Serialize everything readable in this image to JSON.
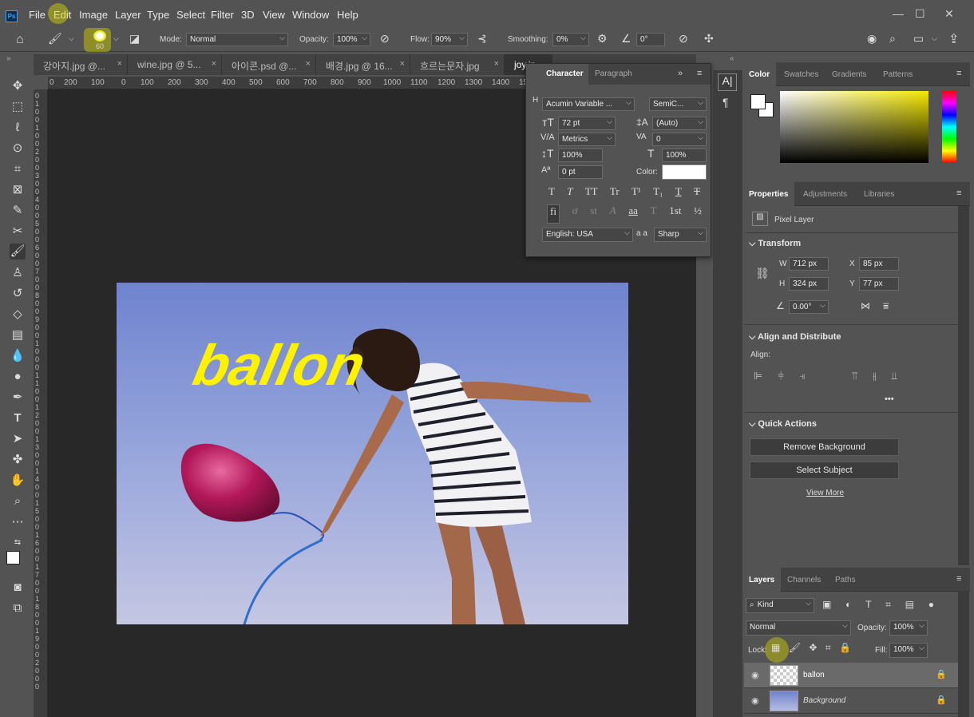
{
  "menu": [
    "File",
    "Edit",
    "Image",
    "Layer",
    "Type",
    "Select",
    "Filter",
    "3D",
    "View",
    "Window",
    "Help"
  ],
  "app_logo": "Ps",
  "window_controls": {
    "minimize": "—",
    "restore": "☐",
    "close": "✕"
  },
  "options": {
    "brush_size": "60",
    "mode_label": "Mode:",
    "mode_value": "Normal",
    "opacity_label": "Opacity:",
    "opacity_value": "100%",
    "flow_label": "Flow:",
    "flow_value": "90%",
    "smoothing_label": "Smoothing:",
    "smoothing_value": "0%",
    "angle_value": "0°"
  },
  "tabs": [
    {
      "label": "강아지.jpg @..."
    },
    {
      "label": "wine.jpg @ 5..."
    },
    {
      "label": "아이콘.psd @..."
    },
    {
      "label": "배경.jpg @ 16..."
    },
    {
      "label": "흐르는문자.jpg"
    },
    {
      "label": "joy.jp"
    }
  ],
  "ruler_h": [
    "0",
    "200",
    "100",
    "0",
    "100",
    "200",
    "300",
    "400",
    "500",
    "600",
    "700",
    "800",
    "900",
    "1000",
    "1100",
    "1200",
    "1300",
    "1400",
    "15"
  ],
  "ruler_v": [
    "0",
    "1",
    "0",
    "0",
    "1",
    "0",
    "0",
    "2",
    "0",
    "0",
    "3",
    "0",
    "0",
    "4",
    "0",
    "0",
    "5",
    "0",
    "0",
    "6",
    "0",
    "0",
    "7",
    "0",
    "0",
    "8",
    "0",
    "0",
    "9",
    "0",
    "0",
    "1",
    "0",
    "0",
    "0",
    "1",
    "1",
    "0",
    "0",
    "1",
    "2",
    "0",
    "0",
    "1",
    "3",
    "0",
    "0",
    "1",
    "4",
    "0",
    "0",
    "1",
    "5",
    "0",
    "0",
    "1",
    "6",
    "0",
    "0",
    "1",
    "7",
    "0",
    "0",
    "1",
    "8",
    "0",
    "0",
    "1",
    "9",
    "0",
    "0",
    "2",
    "0",
    "0",
    "0"
  ],
  "canvas_text": "ballon",
  "character_panel": {
    "tab_character": "Character",
    "tab_paragraph": "Paragraph",
    "font_family": "Acumin Variable ...",
    "font_style": "SemiC...",
    "font_size": "72 pt",
    "leading": "(Auto)",
    "kerning": "Metrics",
    "tracking": "0",
    "vertical_scale": "100%",
    "horizontal_scale": "100%",
    "baseline_shift": "0 pt",
    "color_label": "Color:",
    "language": "English: USA",
    "aa_label": "a a",
    "antialias": "Sharp",
    "style_buttons": [
      "T",
      "T",
      "TT",
      "Tr",
      "T¹",
      "T₁",
      "T",
      "T"
    ],
    "opentype_buttons": [
      "fi",
      "ơ",
      "st",
      "A",
      "aa",
      "T",
      "1st",
      "½"
    ],
    "h_label": "H"
  },
  "color_panel": {
    "tabs": [
      "Color",
      "Swatches",
      "Gradients",
      "Patterns"
    ]
  },
  "properties_panel": {
    "tabs": [
      "Properties",
      "Adjustments",
      "Libraries"
    ],
    "layer_type": "Pixel Layer",
    "transform_title": "Transform",
    "w_label": "W",
    "w_value": "712 px",
    "h_label": "H",
    "h_value": "324 px",
    "x_label": "X",
    "x_value": "85 px",
    "y_label": "Y",
    "y_value": "77 px",
    "angle_value": "0.00°",
    "align_title": "Align and Distribute",
    "align_label": "Align:",
    "more": "•••",
    "quick_title": "Quick Actions",
    "remove_bg": "Remove Background",
    "select_subject": "Select Subject",
    "view_more": "View More"
  },
  "layers_panel": {
    "tabs": [
      "Layers",
      "Channels",
      "Paths"
    ],
    "filter_kind": "Kind",
    "blend_mode": "Normal",
    "opacity_label": "Opacity:",
    "opacity_value": "100%",
    "lock_label": "Lock:",
    "fill_label": "Fill:",
    "fill_value": "100%",
    "layers": [
      {
        "name": "ballon"
      },
      {
        "name": "Background"
      }
    ]
  },
  "colors": {
    "accent_yellow": "#ffff00",
    "canvas_bg": "#282828",
    "ui_bg": "#535353"
  }
}
